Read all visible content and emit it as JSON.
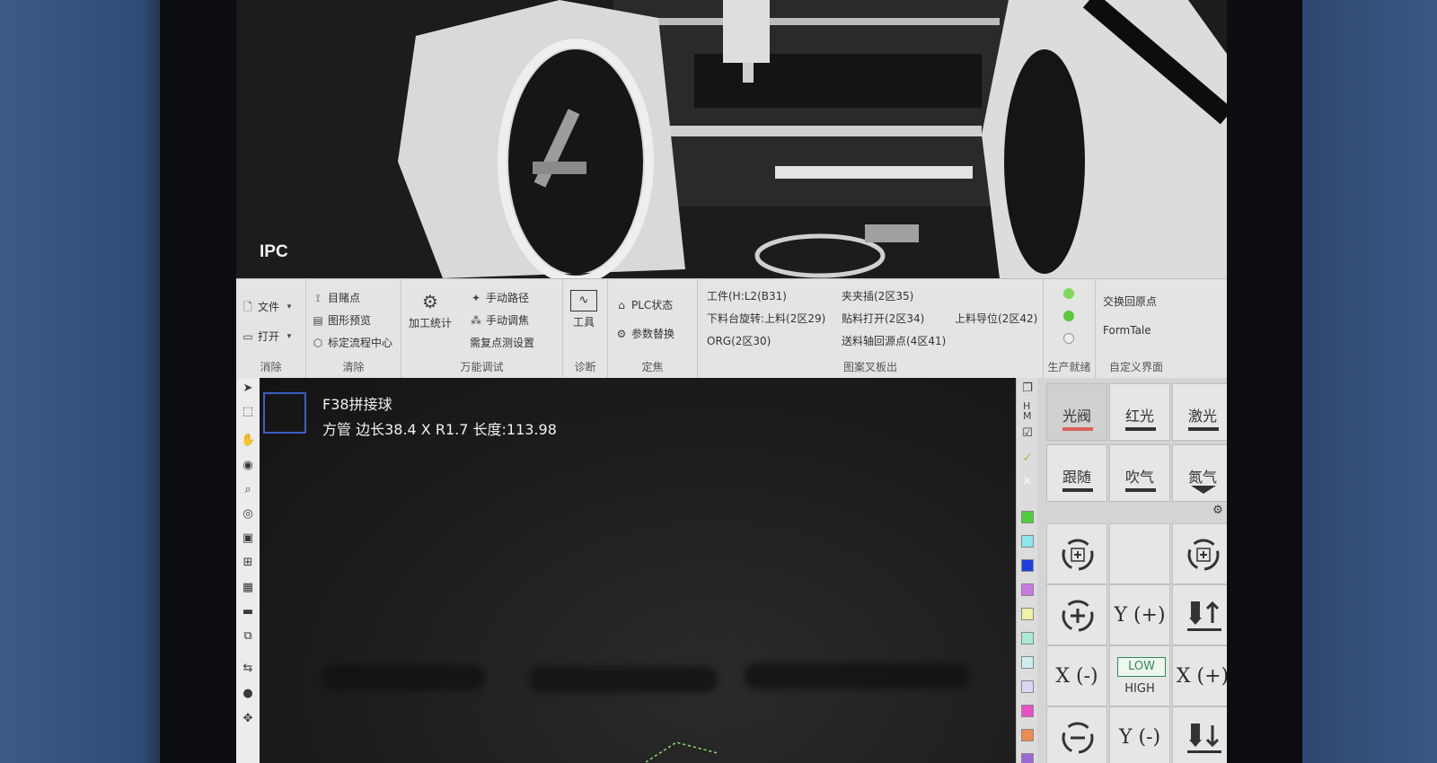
{
  "camera": {
    "label": "IPC"
  },
  "ribbon": {
    "group1": {
      "title": "消除",
      "file": "文件",
      "open": "打开"
    },
    "group2": {
      "title": "清除",
      "items": [
        "目赌点",
        "图形预览",
        "标定流程中心"
      ]
    },
    "group3": {
      "title": "万能调试",
      "process": "加工统计",
      "items": [
        "手动路径",
        "手动调焦",
        "需复点测设置"
      ]
    },
    "group4": {
      "title": "诊断",
      "tools": "工具"
    },
    "group5": {
      "title": "定焦",
      "plc": "PLC状态",
      "params": "参数替换"
    },
    "group6": {
      "title": "图案叉板出",
      "items": [
        "工件(H:L2(B31)",
        "夹夹插(2区35)",
        "下料台旋转:上料(2区29)",
        "贴料打开(2区34)",
        "上料导位(2区42)",
        "ORG(2区30)",
        "送料轴回源点(4区41)"
      ]
    },
    "group7": {
      "title": "生产就绪",
      "leds": [
        "#7fd85a",
        "#59c83a",
        "#eeeeee"
      ]
    },
    "group8": {
      "title": "自定义界面",
      "items": [
        "交换回原点",
        "FormTale"
      ]
    }
  },
  "part": {
    "name": "F38拼接球",
    "desc": "方管 边长38.4 X R1.7 长度:113.98"
  },
  "colors": [
    "#4fcf3f",
    "#8ee6ee",
    "#1e3fdc",
    "#c77ae0",
    "#f0f0a6",
    "#a9ead2",
    "#cdeff0",
    "#d8d8f4",
    "#ea4fc8",
    "#ec8b54",
    "#9a6ad2"
  ],
  "panel": {
    "buttons": [
      {
        "label": "光阀",
        "bar": "#d9605a"
      },
      {
        "label": "红光",
        "bar": "#333333"
      },
      {
        "label": "激光",
        "bar": "#333333"
      },
      {
        "label": "跟随",
        "bar": "#333333"
      },
      {
        "label": "吹气",
        "bar": "#333333"
      },
      {
        "label": "氮气",
        "bar": "#333333"
      }
    ],
    "jog": {
      "y_plus": "Y (+)",
      "y_minus": "Y (-)",
      "x_minus": "X (-)",
      "x_plus": "X (+)",
      "low": "LOW",
      "high": "HIGH"
    }
  },
  "icons": {
    "toolbar": [
      "cursor-icon",
      "select-icon",
      "hand-icon",
      "eye-icon",
      "zoom-icon",
      "circle-select-icon",
      "frame-icon",
      "align-icon",
      "layer-icon",
      "film-icon",
      "copy-icon",
      "swap-icon",
      "drop-icon",
      "move-icon"
    ]
  }
}
